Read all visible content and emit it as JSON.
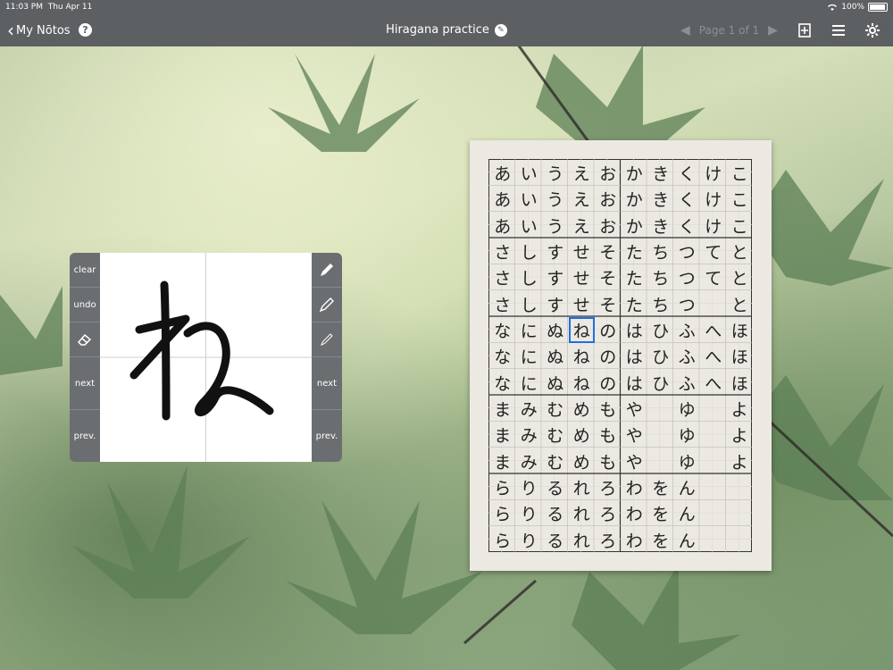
{
  "status": {
    "time": "11:03 PM",
    "date": "Thu Apr 11",
    "battery": "100%"
  },
  "nav": {
    "back_label": "My Nōtos",
    "title": "Hiragana practice",
    "page_label": "Page 1 of 1"
  },
  "draw_panel": {
    "left_tools": [
      "clear",
      "undo",
      "eraser-icon",
      "next",
      "prev."
    ],
    "right_tools": [
      "pen-icon",
      "pencil-icon",
      "thin-pencil-icon",
      "next",
      "prev."
    ],
    "current_char": "ね"
  },
  "worksheet": {
    "rows": [
      [
        "あ",
        "い",
        "う",
        "え",
        "お",
        "か",
        "き",
        "く",
        "け",
        "こ"
      ],
      [
        "あ",
        "い",
        "う",
        "え",
        "お",
        "か",
        "き",
        "く",
        "け",
        "こ"
      ],
      [
        "あ",
        "い",
        "う",
        "え",
        "お",
        "か",
        "き",
        "く",
        "け",
        "こ"
      ],
      [
        "さ",
        "し",
        "す",
        "せ",
        "そ",
        "た",
        "ち",
        "つ",
        "て",
        "と"
      ],
      [
        "さ",
        "し",
        "す",
        "せ",
        "そ",
        "た",
        "ち",
        "つ",
        "て",
        "と"
      ],
      [
        "さ",
        "し",
        "す",
        "せ",
        "そ",
        "た",
        "ち",
        "つ",
        "",
        "と"
      ],
      [
        "な",
        "に",
        "ぬ",
        "ね",
        "の",
        "は",
        "ひ",
        "ふ",
        "へ",
        "ほ"
      ],
      [
        "な",
        "に",
        "ぬ",
        "ね",
        "の",
        "は",
        "ひ",
        "ふ",
        "へ",
        "ほ"
      ],
      [
        "な",
        "に",
        "ぬ",
        "ね",
        "の",
        "は",
        "ひ",
        "ふ",
        "へ",
        "ほ"
      ],
      [
        "ま",
        "み",
        "む",
        "め",
        "も",
        "や",
        "",
        "ゆ",
        "",
        "よ"
      ],
      [
        "ま",
        "み",
        "む",
        "め",
        "も",
        "や",
        "",
        "ゆ",
        "",
        "よ"
      ],
      [
        "ま",
        "み",
        "む",
        "め",
        "も",
        "や",
        "",
        "ゆ",
        "",
        "よ"
      ],
      [
        "ら",
        "り",
        "る",
        "れ",
        "ろ",
        "わ",
        "を",
        "ん",
        "",
        ""
      ],
      [
        "ら",
        "り",
        "る",
        "れ",
        "ろ",
        "わ",
        "を",
        "ん",
        "",
        ""
      ],
      [
        "ら",
        "り",
        "る",
        "れ",
        "ろ",
        "わ",
        "を",
        "ん",
        "",
        ""
      ]
    ],
    "highlight": {
      "row": 6,
      "col": 3
    },
    "highlight_color": "#1e6fe0"
  }
}
